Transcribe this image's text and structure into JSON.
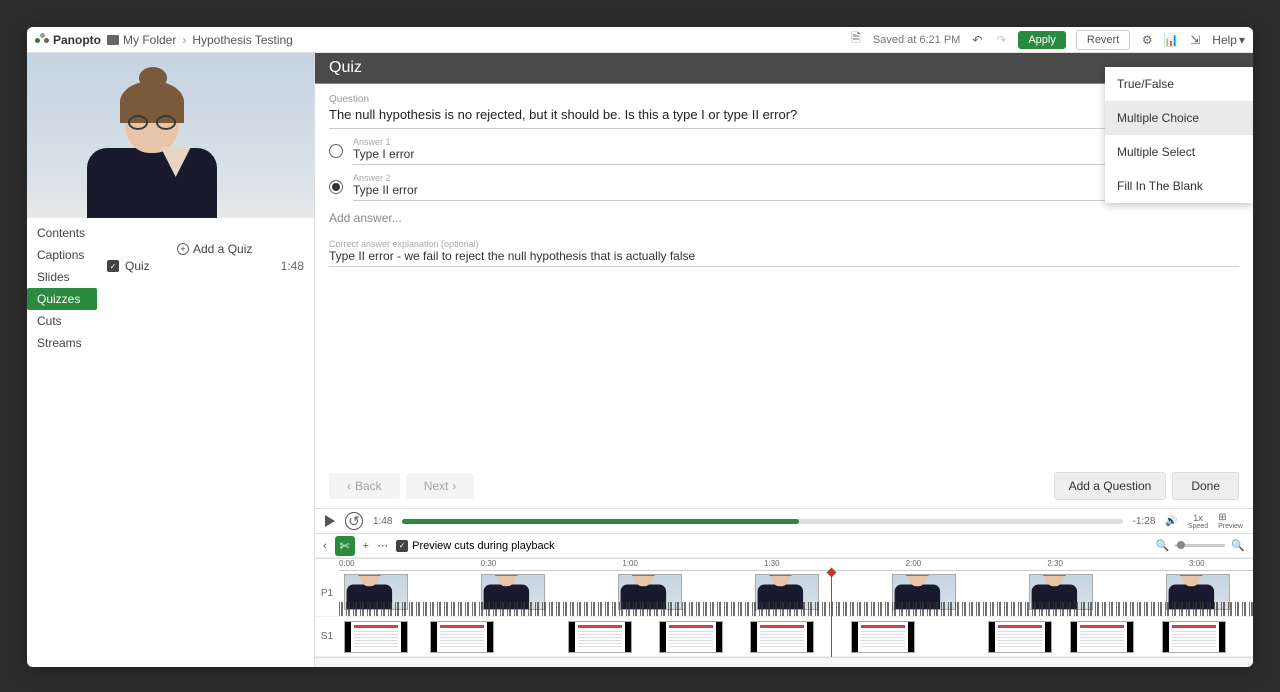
{
  "brand": "Panopto",
  "breadcrumb": {
    "folder": "My Folder",
    "title": "Hypothesis Testing"
  },
  "topbar": {
    "saved_status": "Saved at 6:21 PM",
    "apply": "Apply",
    "revert": "Revert",
    "help": "Help"
  },
  "sidebar": {
    "items": [
      "Contents",
      "Captions",
      "Slides",
      "Quizzes",
      "Cuts",
      "Streams"
    ],
    "active_index": 3,
    "add_quiz": "Add a Quiz",
    "quiz_entry": {
      "label": "Quiz",
      "time": "1:48"
    }
  },
  "quiz": {
    "title": "Quiz",
    "question_label": "Question",
    "question_text": "The null hypothesis is no rejected, but it should be. Is this a type I or type II error?",
    "answers": [
      {
        "label": "Answer 1",
        "text": "Type I error",
        "selected": false
      },
      {
        "label": "Answer 2",
        "text": "Type II error",
        "selected": true
      }
    ],
    "add_answer": "Add answer...",
    "explanation_label": "Correct answer explanation (optional)",
    "explanation_text": "Type II error - we fail to reject the null hypothesis that is actually false",
    "types": [
      "True/False",
      "Multiple Choice",
      "Multiple Select",
      "Fill In The Blank"
    ],
    "type_selected_index": 1,
    "back": "Back",
    "next": "Next",
    "add_question": "Add a Question",
    "done": "Done"
  },
  "player": {
    "current_time": "1:48",
    "remaining": "-1:28",
    "speed": "1x",
    "speed_label": "Speed",
    "preview_label": "Preview"
  },
  "timeline": {
    "preview_cuts": "Preview cuts during playback",
    "tracks": {
      "p1": "P1",
      "s1": "S1"
    },
    "ticks": [
      "0:00",
      "0:30",
      "1:00",
      "1:30",
      "2:00",
      "2:30",
      "3:00"
    ]
  }
}
